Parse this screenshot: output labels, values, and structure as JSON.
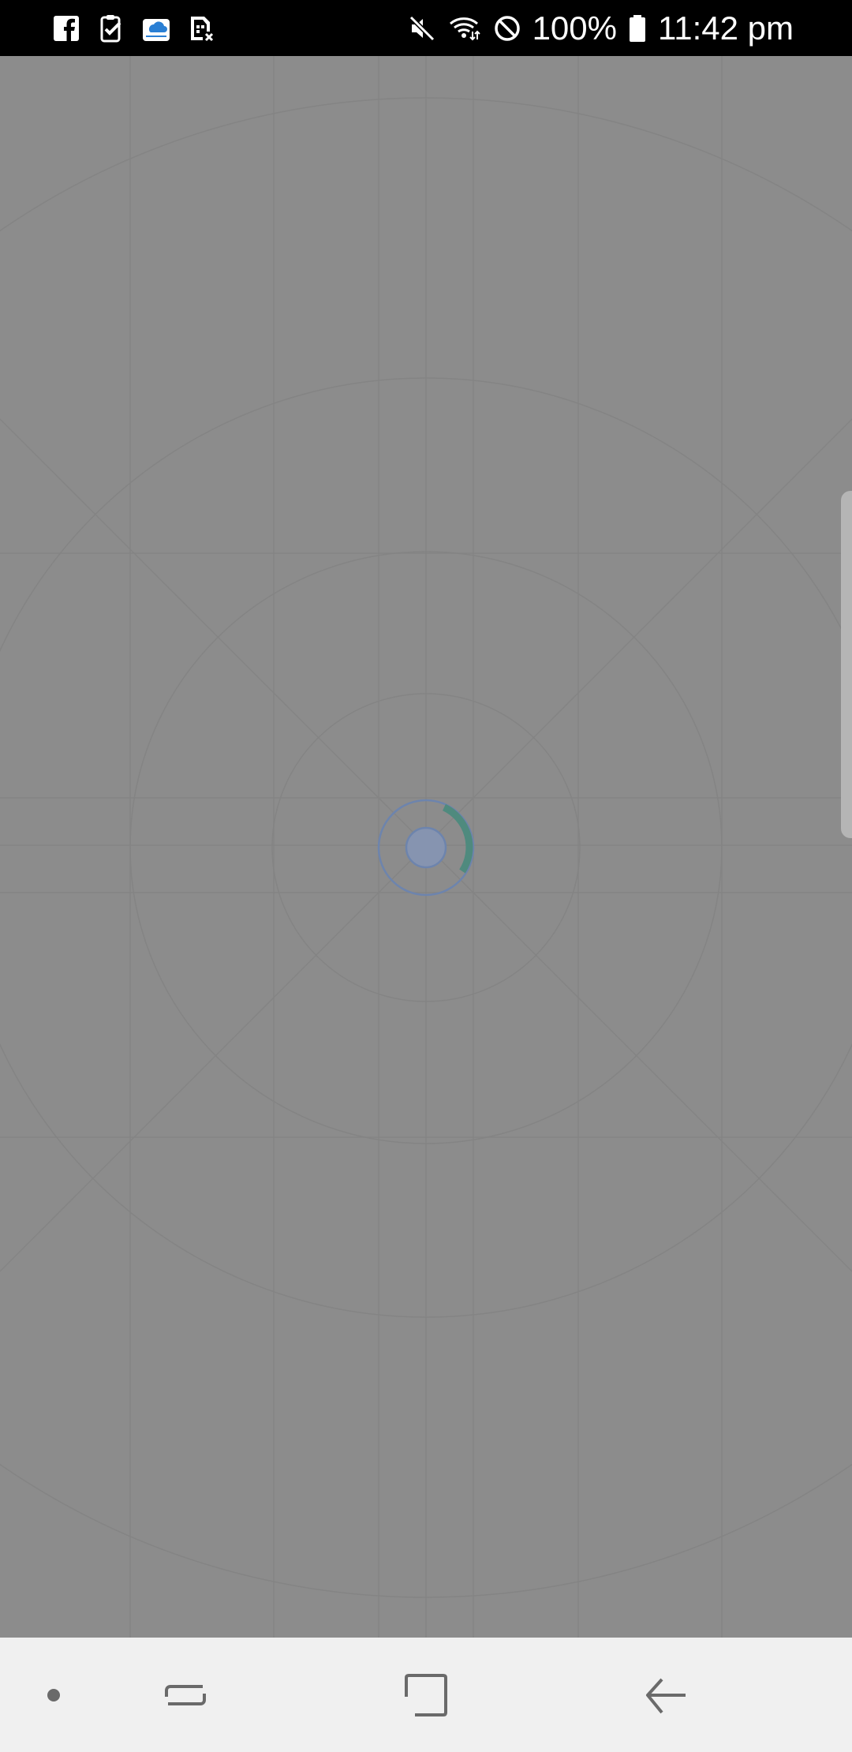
{
  "status_bar": {
    "notification_icons": [
      "facebook-icon",
      "task-check-icon",
      "cloud-calendar-icon",
      "sim-error-icon"
    ],
    "system_icons": [
      "mute-icon",
      "wifi-icon",
      "do-not-disturb-icon",
      "battery-icon"
    ],
    "battery_level": "100%",
    "time": "11:42 pm"
  },
  "main": {
    "state": "loading",
    "spinner_accent": "#4f8a7e",
    "spinner_ring": "#6d84ad"
  },
  "nav_bar": {
    "buttons": [
      "dot-icon",
      "recent-apps-icon",
      "home-icon",
      "back-icon"
    ]
  }
}
